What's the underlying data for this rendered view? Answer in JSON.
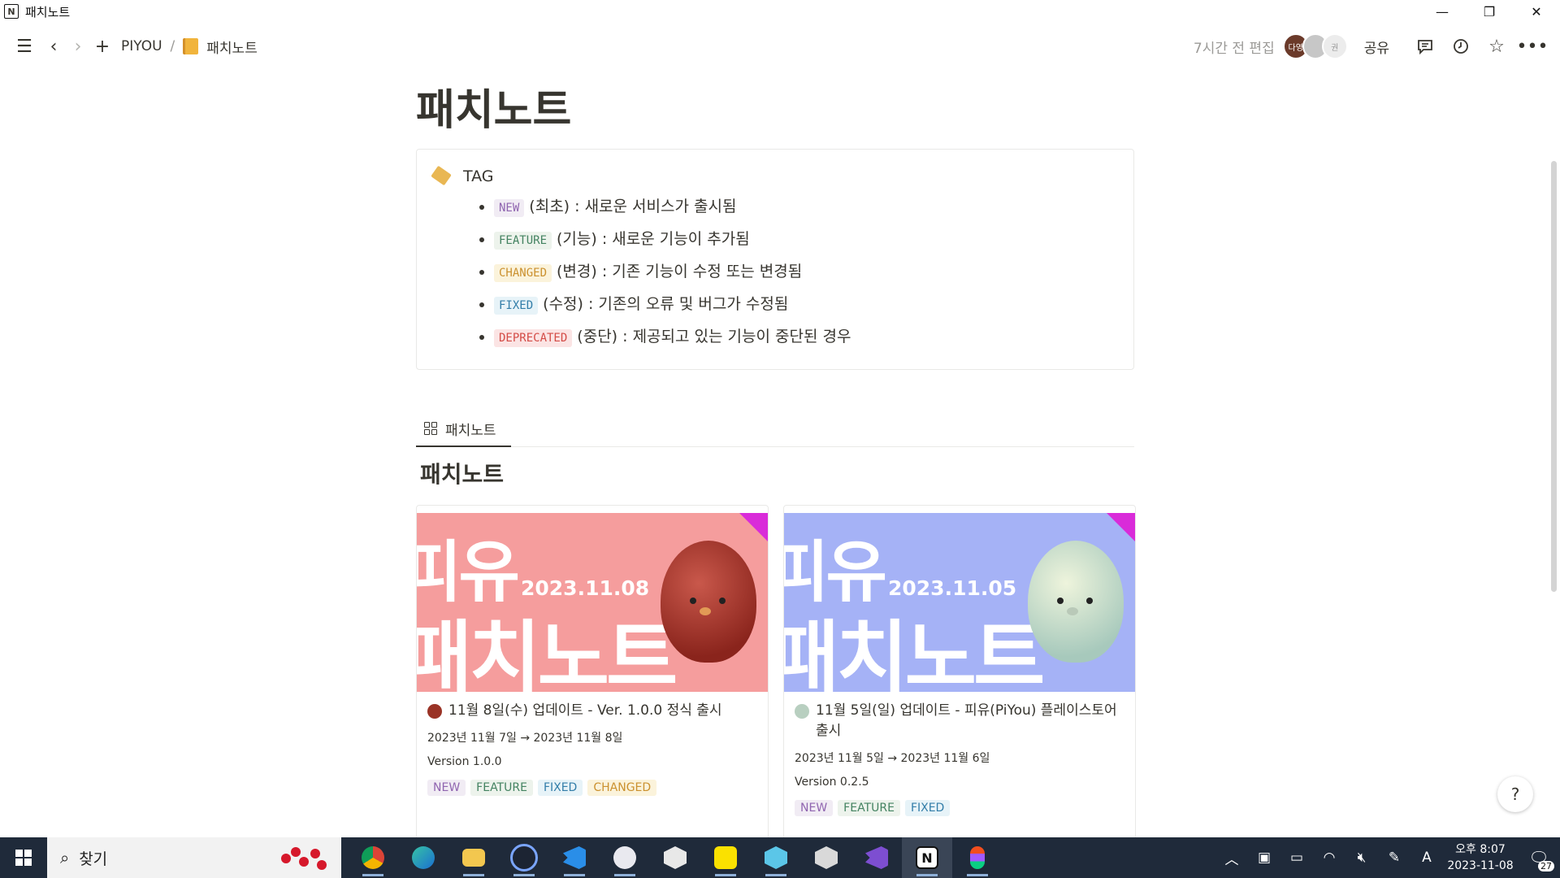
{
  "window": {
    "title": "패치노트"
  },
  "topbar": {
    "breadcrumb": [
      "PIYOU",
      "패치노트"
    ],
    "edited": "7시간 전 편집",
    "avatar_label": "다영",
    "avatar_label2": "권",
    "share": "공유"
  },
  "page": {
    "title": "패치노트",
    "callout": {
      "title": "TAG",
      "items": [
        {
          "code": "NEW",
          "desc": "(최초) : 새로운 서비스가 출시됨",
          "color": "#9065b0"
        },
        {
          "code": "FEATURE",
          "desc": "(기능) : 새로운 기능이 추가됨",
          "color": "#448361"
        },
        {
          "code": "CHANGED",
          "desc": "(변경) : 기존 기능이 수정 또는 변경됨",
          "color": "#cb912f"
        },
        {
          "code": "FIXED",
          "desc": "(수정) : 기존의 오류 및 버그가 수정됨",
          "color": "#337ea9"
        },
        {
          "code": "DEPRECATED",
          "desc": "(중단) : 제공되고 있는 기능이 중단된 경우",
          "color": "#d44c47"
        }
      ]
    },
    "view_tab": "패치노트",
    "db_title": "패치노트",
    "cards": [
      {
        "cover_text1": "피유",
        "cover_text2": "패치노트",
        "cover_date": "2023.11.08",
        "title": "11월 8일(수) 업데이트 - Ver. 1.0.0 정식 출시",
        "dates": "2023년 11월 7일 → 2023년 11월 8일",
        "version": "Version 1.0.0",
        "tags": [
          "NEW",
          "FEATURE",
          "FIXED",
          "CHANGED"
        ]
      },
      {
        "cover_text1": "피유",
        "cover_text2": "패치노트",
        "cover_date": "2023.11.05",
        "title": "11월 5일(일) 업데이트 - 피유(PiYou) 플레이스토어 출시",
        "dates": "2023년 11월 5일 → 2023년 11월 6일",
        "version": "Version 0.2.5",
        "tags": [
          "NEW",
          "FEATURE",
          "FIXED"
        ]
      }
    ]
  },
  "help": "?",
  "taskbar": {
    "search_placeholder": "찾기",
    "apps": [
      "chrome",
      "edge",
      "file-explorer",
      "clock-app",
      "vscode",
      "paint-app",
      "unity",
      "kakaotalk",
      "devtool-app",
      "unity-hub",
      "visual-studio",
      "notion",
      "figma"
    ],
    "clock_time": "오후 8:07",
    "clock_date": "2023-11-08",
    "input_indicator": "A",
    "notification_count": "27"
  }
}
